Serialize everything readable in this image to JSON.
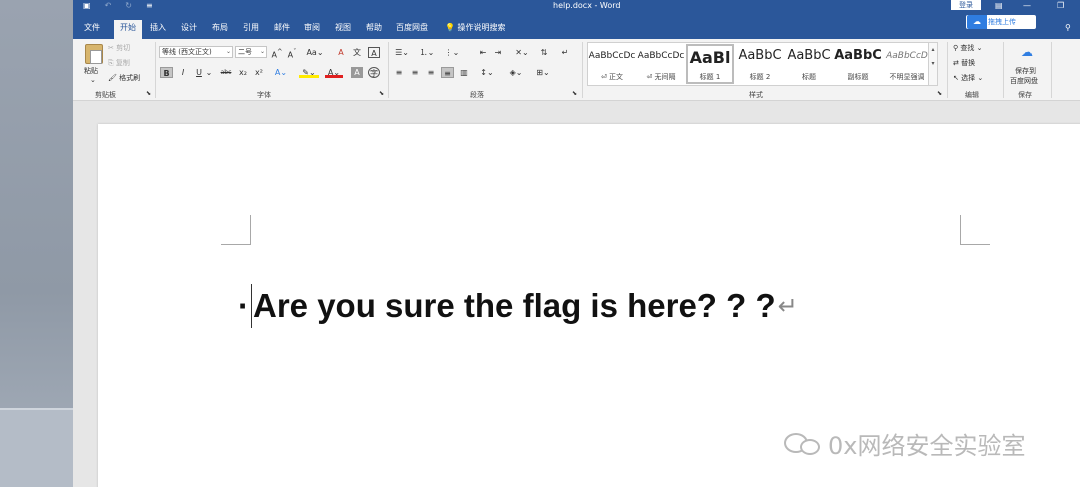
{
  "window": {
    "title": "help.docx - Word",
    "login_label": "登录",
    "upload_label": "拖拽上传"
  },
  "tabs": [
    "文件",
    "开始",
    "插入",
    "设计",
    "布局",
    "引用",
    "邮件",
    "审阅",
    "视图",
    "帮助",
    "百度网盘"
  ],
  "active_tab": "开始",
  "tell_me": "操作说明搜索",
  "clipboard": {
    "paste": "粘贴",
    "cut": "剪切",
    "copy": "复制",
    "format_painter": "格式刷",
    "group": "剪贴板"
  },
  "font": {
    "name": "等线 (西文正文)",
    "size": "二号",
    "group": "字体"
  },
  "paragraph": {
    "group": "段落"
  },
  "styles": {
    "group": "样式",
    "items": [
      {
        "sample": "AaBbCcDc",
        "name": "⏎ 正文"
      },
      {
        "sample": "AaBbCcDc",
        "name": "⏎ 无间隔"
      },
      {
        "sample": "AaBl",
        "name": "标题 1"
      },
      {
        "sample": "AaBbC",
        "name": "标题 2"
      },
      {
        "sample": "AaBbC",
        "name": "标题"
      },
      {
        "sample": "AaBbC",
        "name": "副标题"
      },
      {
        "sample": "AaBbCcD",
        "name": "不明显强调"
      }
    ]
  },
  "editing": {
    "find": "查找",
    "replace": "替换",
    "select": "选择",
    "group": "编辑"
  },
  "save": {
    "label1": "保存到",
    "label2": "百度网盘",
    "group": "保存"
  },
  "document": {
    "text": "Are you sure the flag is here? ? ?"
  },
  "watermark": "0x网络安全实验室"
}
